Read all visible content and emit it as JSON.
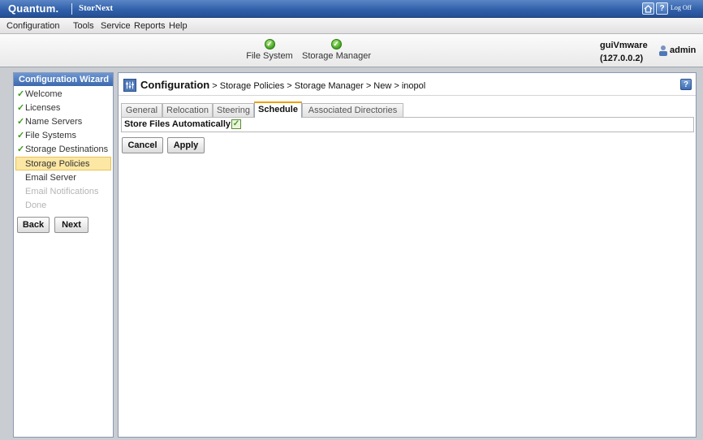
{
  "app": {
    "brand": "Quantum.",
    "product": "StorNext",
    "logoff": "Log Off"
  },
  "menu": [
    "Configuration",
    "Tools",
    "Service",
    "Reports",
    "Help"
  ],
  "status": {
    "items": [
      {
        "label": "File System",
        "state": "ok"
      },
      {
        "label": "Storage Manager",
        "state": "ok"
      }
    ],
    "host": "guiVmware",
    "ip": "(127.0.0.2)",
    "user": "admin"
  },
  "wizard": {
    "title": "Configuration Wizard",
    "steps": [
      {
        "label": "Welcome",
        "state": "done"
      },
      {
        "label": "Licenses",
        "state": "done"
      },
      {
        "label": "Name Servers",
        "state": "done"
      },
      {
        "label": "File Systems",
        "state": "done"
      },
      {
        "label": "Storage Destinations",
        "state": "done"
      },
      {
        "label": "Storage Policies",
        "state": "active"
      },
      {
        "label": "Email Server",
        "state": "pending"
      },
      {
        "label": "Email Notifications",
        "state": "disabled"
      },
      {
        "label": "Done",
        "state": "disabled"
      }
    ],
    "back_label": "Back",
    "next_label": "Next"
  },
  "main": {
    "breadcrumb_root": "Configuration",
    "breadcrumb_rest": " > Storage Policies > Storage Manager > New > inopol",
    "tabs": [
      "General",
      "Relocation",
      "Steering",
      "Schedule",
      "Associated Directories"
    ],
    "selected_tab": "Schedule",
    "store_files_label": "Store Files Automatically",
    "store_files_checked": true,
    "cancel_label": "Cancel",
    "apply_label": "Apply"
  },
  "colors": {
    "accent": "#2f5ea8",
    "ok": "#3fa21c",
    "active_step": "#fce7a4",
    "tab_highlight": "#f0a000"
  }
}
